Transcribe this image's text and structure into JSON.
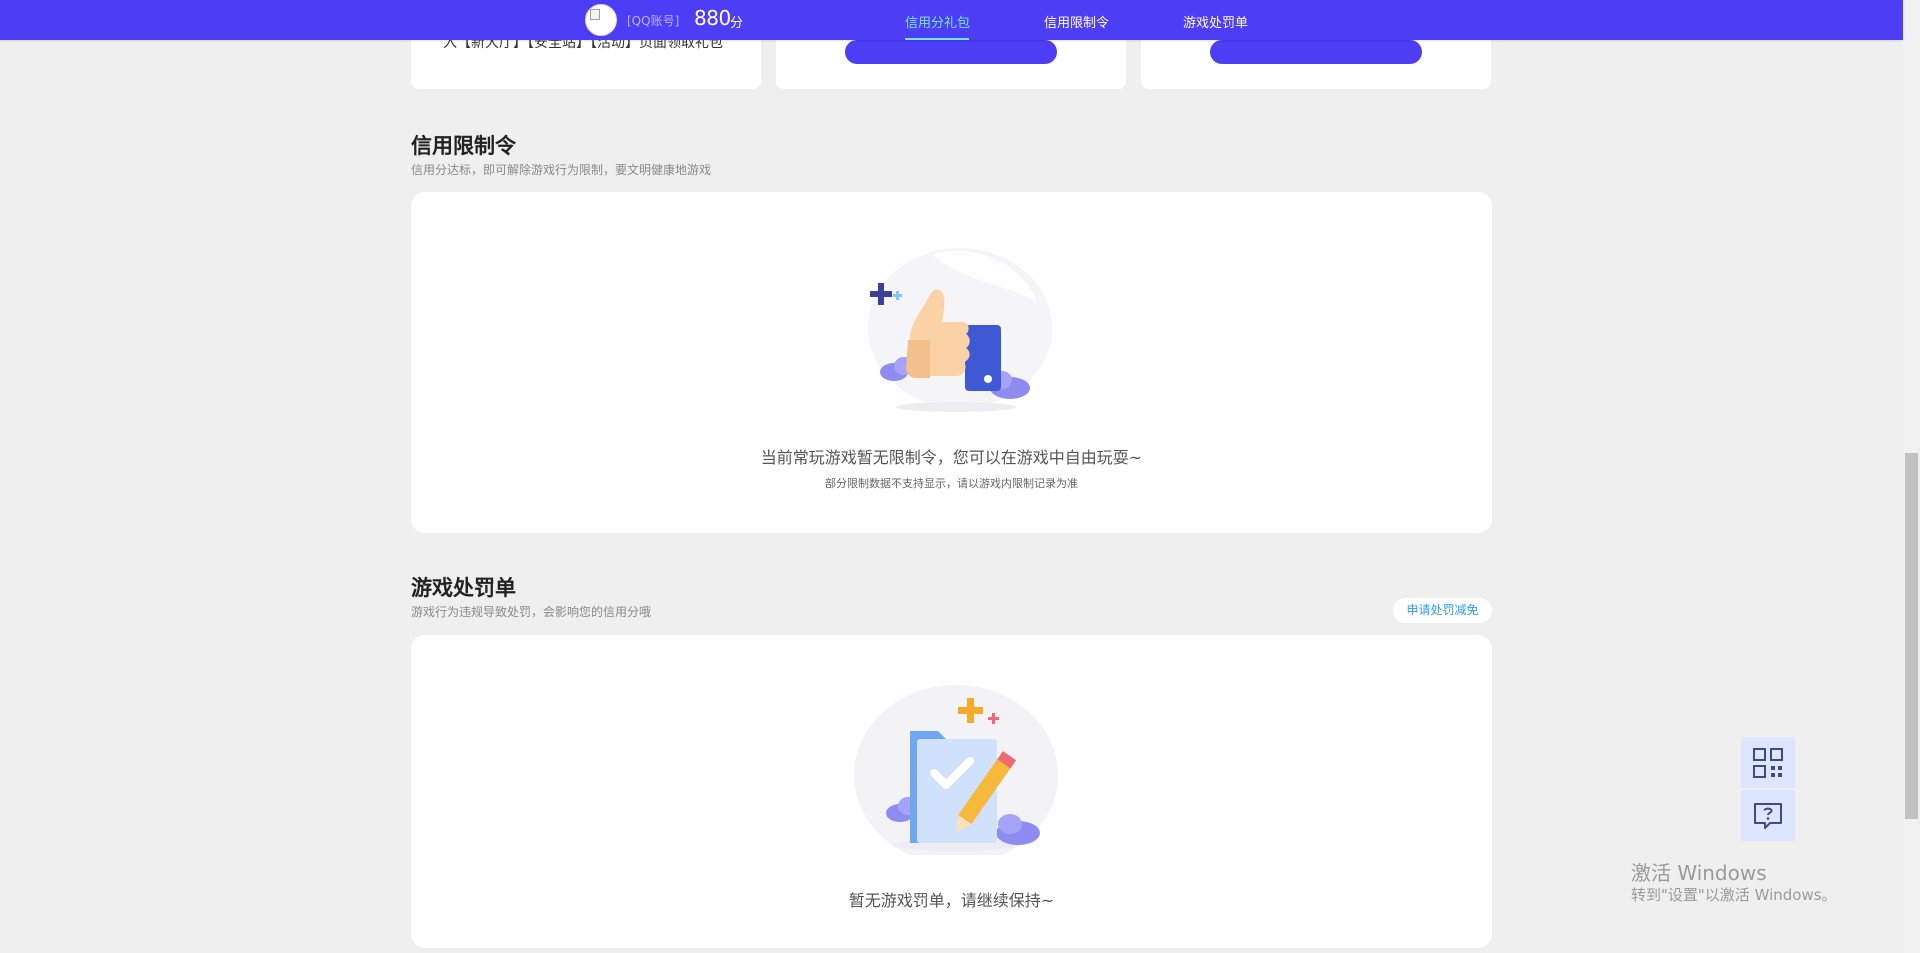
{
  "header": {
    "account_label": "[QQ账号]",
    "score": "880",
    "score_unit": "分",
    "tabs": [
      {
        "label": "信用分礼包",
        "active": true
      },
      {
        "label": "信用限制令",
        "active": false
      },
      {
        "label": "游戏处罚单",
        "active": false
      }
    ],
    "accent_color": "#4d3df5",
    "active_tab_color": "#79e6ff"
  },
  "prev_section": {
    "card_text": "入【新大厅】【安全站】【活动】页面领取礼包"
  },
  "restriction": {
    "title": "信用限制令",
    "subtitle": "信用分达标，即可解除游戏行为限制，要文明健康地游戏",
    "empty_text": "当前常玩游戏暂无限制令，您可以在游戏中自由玩耍~",
    "note": "部分限制数据不支持显示，请以游戏内限制记录为准",
    "illustration_icon": "thumbs-up-icon"
  },
  "penalty": {
    "title": "游戏处罚单",
    "subtitle": "游戏行为违规导致处罚，会影响您的信用分哦",
    "apply_button": "申请处罚减免",
    "empty_text": "暂无游戏罚单，请继续保持~",
    "illustration_icon": "checked-document-icon"
  },
  "floating_tools": [
    {
      "icon": "qr-code-icon"
    },
    {
      "icon": "feedback-icon"
    }
  ],
  "watermark": {
    "line1": "激活 Windows",
    "line2": "转到\"设置\"以激活 Windows。"
  }
}
